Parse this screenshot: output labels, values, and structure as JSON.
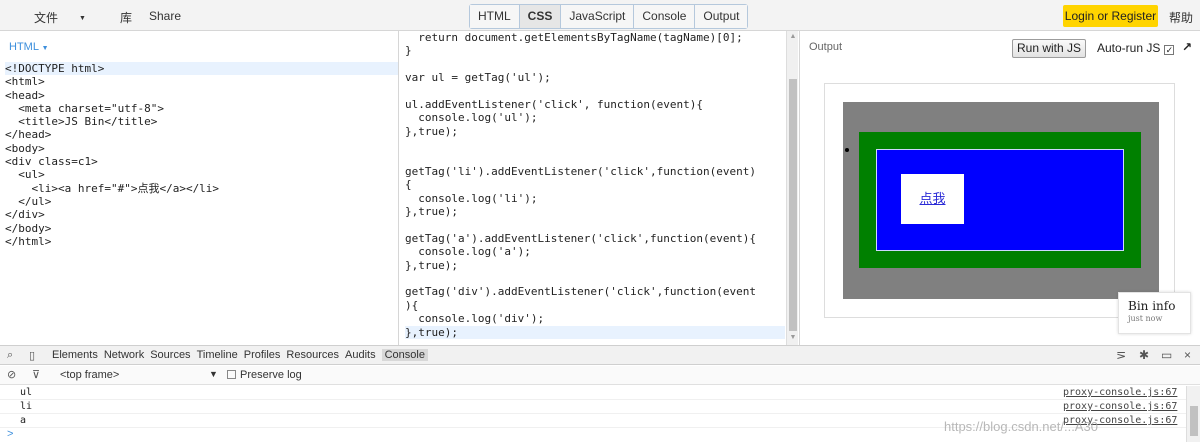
{
  "menu": {
    "file": "文件",
    "library": "库",
    "share": "Share"
  },
  "tabs": [
    {
      "label": "HTML",
      "state": "plain"
    },
    {
      "label": "CSS",
      "state": "active"
    },
    {
      "label": "JavaScript",
      "state": "plain"
    },
    {
      "label": "Console",
      "state": "plain"
    },
    {
      "label": "Output",
      "state": "plain"
    }
  ],
  "account": {
    "login": "Login or Register",
    "help": "帮助"
  },
  "html_panel": {
    "title": "HTML",
    "lines": [
      "<!DOCTYPE html>",
      "<html>",
      "<head>",
      "  <meta charset=\"utf-8\">",
      "  <title>JS Bin</title>",
      "</head>",
      "<body>",
      "<div class=c1>",
      "  <ul>",
      "    <li><a href=\"#\">点我</a></li>",
      "  </ul>",
      "</div>",
      "</body>",
      "</html>"
    ]
  },
  "js_panel": {
    "lines": [
      "  return document.getElementsByTagName(tagName)[0];",
      "}",
      "",
      "var ul = getTag('ul');",
      "",
      "ul.addEventListener('click', function(event){",
      "  console.log('ul');",
      "},true);",
      "",
      "",
      "getTag('li').addEventListener('click',function(event)",
      "{",
      "  console.log('li');",
      "},true);",
      "",
      "getTag('a').addEventListener('click',function(event){",
      "  console.log('a');",
      "},true);",
      "",
      "getTag('div').addEventListener('click',function(event",
      "){",
      "  console.log('div');",
      "},true);"
    ]
  },
  "output_panel": {
    "label": "Output",
    "run_button": "Run with JS",
    "autorun_label": "Auto-run JS",
    "autorun_checked": true,
    "popout_icon": "arrow-up-right-icon",
    "link_text": "点我",
    "colors": {
      "outer": "#808080",
      "middle": "#008000",
      "inner": "#0000ff",
      "link_box": "#ffffff"
    },
    "bin_info": {
      "title": "Bin info",
      "subtitle": "just now"
    }
  },
  "devtools": {
    "tabs": [
      "Elements",
      "Network",
      "Sources",
      "Timeline",
      "Profiles",
      "Resources",
      "Audits",
      "Console"
    ],
    "active_tab": "Console",
    "frame_select": "<top frame>",
    "preserve_log": "Preserve log",
    "logs": [
      {
        "message": "ul",
        "source": "proxy-console.js:67"
      },
      {
        "message": "li",
        "source": "proxy-console.js:67"
      },
      {
        "message": "a",
        "source": "proxy-console.js:67"
      }
    ],
    "prompt": ">"
  },
  "watermark": "https://blog.csdn.net/...A30"
}
